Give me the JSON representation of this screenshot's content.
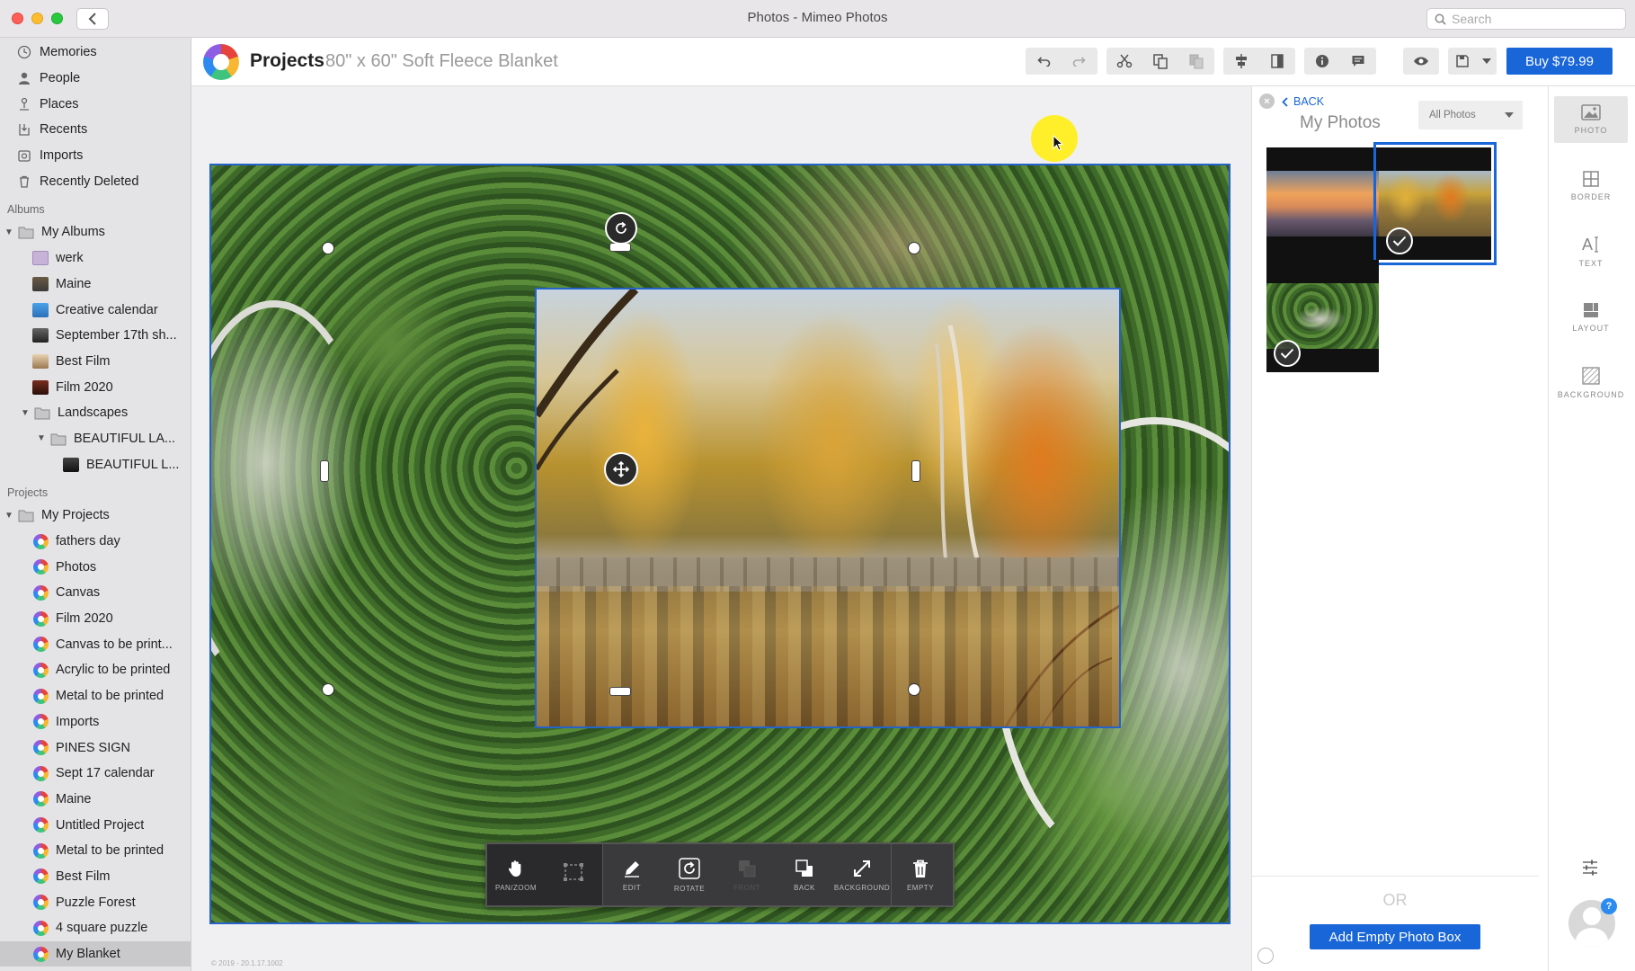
{
  "window": {
    "title": "Photos - Mimeo Photos",
    "search_placeholder": "Search"
  },
  "sidebar": {
    "top_items": [
      {
        "label": "Memories",
        "icon": "memories-icon"
      },
      {
        "label": "People",
        "icon": "person-icon"
      },
      {
        "label": "Places",
        "icon": "pin-icon"
      },
      {
        "label": "Recents",
        "icon": "recents-icon"
      },
      {
        "label": "Imports",
        "icon": "imports-icon"
      },
      {
        "label": "Recently Deleted",
        "icon": "trash-icon"
      }
    ],
    "albums_heading": "Albums",
    "albums": [
      {
        "label": "My Albums",
        "level": 0
      },
      {
        "label": "werk",
        "level": 1
      },
      {
        "label": "Maine",
        "level": 1
      },
      {
        "label": "Creative calendar",
        "level": 1
      },
      {
        "label": "September 17th sh...",
        "level": 1
      },
      {
        "label": "Best Film",
        "level": 1
      },
      {
        "label": "Film 2020",
        "level": 1
      },
      {
        "label": "Landscapes",
        "level": 1
      },
      {
        "label": "BEAUTIFUL LA...",
        "level": 2
      },
      {
        "label": "BEAUTIFUL L...",
        "level": 3
      }
    ],
    "projects_heading": "Projects",
    "projects_root": "My Projects",
    "projects": [
      "fathers day",
      "Photos",
      "Canvas",
      "Film 2020",
      "Canvas to be print...",
      "Acrylic to be printed",
      "Metal to be printed",
      "Imports",
      "PINES SIGN",
      "Sept 17 calendar",
      "Maine",
      "Untitled Project",
      "Metal to be printed",
      "Best Film",
      "Puzzle Forest",
      "4 square puzzle",
      "My Blanket"
    ],
    "selected_project": "My Blanket"
  },
  "header": {
    "title": "Projects",
    "subtitle": "80\" x 60\" Soft Fleece Blanket",
    "buy_label": "Buy $79.99"
  },
  "photo_toolbar": {
    "buttons": [
      {
        "label": "PAN/ZOOM",
        "icon": "hand-icon"
      },
      {
        "label": "",
        "icon": "crop-icon"
      },
      {
        "label": "EDIT",
        "icon": "pencil-icon"
      },
      {
        "label": "ROTATE",
        "icon": "rotate-icon"
      },
      {
        "label": "FRONT",
        "icon": "front-icon"
      },
      {
        "label": "BACK",
        "icon": "back-icon"
      },
      {
        "label": "BACKGROUND",
        "icon": "expand-icon"
      },
      {
        "label": "EMPTY",
        "icon": "trash-icon"
      }
    ]
  },
  "copyright": "© 2019 - 20.1.17.1002",
  "right_panel": {
    "back_label": "BACK",
    "title": "My Photos",
    "filter_value": "All Photos",
    "or_label": "OR",
    "add_button": "Add Empty Photo Box"
  },
  "tools": [
    {
      "label": "PHOTO",
      "icon": "photo-icon"
    },
    {
      "label": "BORDER",
      "icon": "border-icon"
    },
    {
      "label": "TEXT",
      "icon": "text-icon"
    },
    {
      "label": "LAYOUT",
      "icon": "layout-icon"
    },
    {
      "label": "BACKGROUND",
      "icon": "background-icon"
    }
  ],
  "help_badge": "?",
  "colors": {
    "accent": "#1966d9",
    "selection": "#2563c9"
  }
}
